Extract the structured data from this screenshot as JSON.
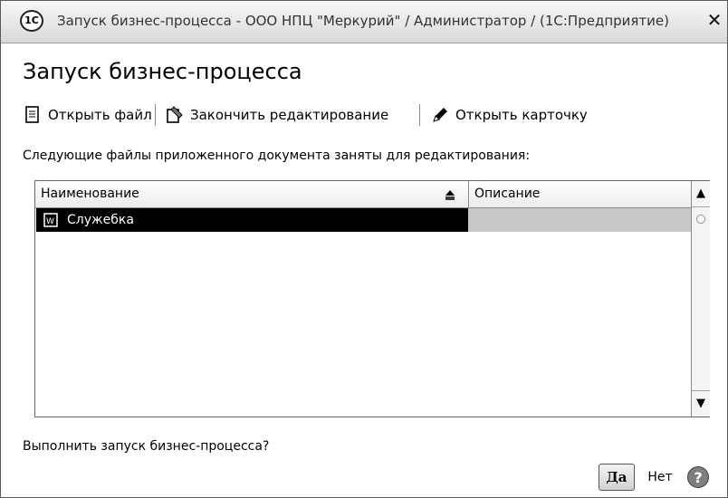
{
  "window": {
    "title": "Запуск бизнес-процесса - ООО НПЦ \"Меркурий\" / Администратор / (1С:Предприятие)",
    "app_icon_text": "1С",
    "close_label": "✕"
  },
  "page": {
    "title": "Запуск бизнес-процесса"
  },
  "toolbar": {
    "open_file": "Открыть файл",
    "finish_editing": "Закончить редактирование",
    "open_card": "Открыть карточку"
  },
  "info": "Следующие файлы приложенного документа заняты для редактирования:",
  "table": {
    "columns": [
      "Наименование",
      "Описание"
    ],
    "rows": [
      {
        "name": "Служебка",
        "description": ""
      }
    ]
  },
  "question": "Выполнить запуск бизнес-процесса?",
  "buttons": {
    "yes": "Да",
    "no": "Нет",
    "help": "?"
  },
  "icons": {
    "app": "1c-logo-icon",
    "open_file": "document-icon",
    "finish_editing": "edit-finish-icon",
    "open_card": "card-pen-icon",
    "row_doc": "word-document-icon"
  }
}
